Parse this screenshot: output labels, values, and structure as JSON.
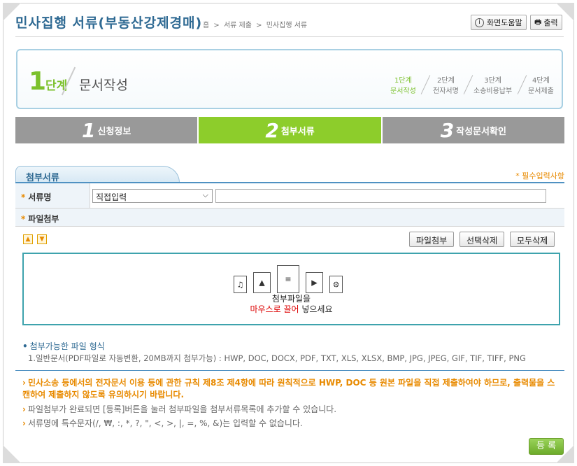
{
  "header": {
    "title": "민사집행 서류(부동산강제경매)",
    "breadcrumb": [
      "홈",
      ">",
      "서류 제출",
      ">",
      "민사집행 서류"
    ],
    "help_label": "화면도움말",
    "print_label": "출력"
  },
  "steps": {
    "current_num": "1",
    "current_label": "단계",
    "current_name": "문서작성",
    "mini": [
      {
        "top": "1단계",
        "bottom": "문서작성"
      },
      {
        "top": "2단계",
        "bottom": "전자서명"
      },
      {
        "top": "3단계",
        "bottom": "소송비용납부"
      },
      {
        "top": "4단계",
        "bottom": "문서제출"
      }
    ]
  },
  "tabs": [
    {
      "num": "1",
      "label": "신청정보"
    },
    {
      "num": "2",
      "label": "첨부서류"
    },
    {
      "num": "3",
      "label": "작성문서확인"
    }
  ],
  "section": {
    "tab_label": "첨부서류",
    "required_note": "* 필수입력사항",
    "doc_name_label": "서류명",
    "doc_select_value": "직접입력",
    "file_attach_label": "파일첨부",
    "buttons": {
      "attach": "파일첨부",
      "delete_selected": "선택삭제",
      "delete_all": "모두삭제"
    },
    "drop_line1": "첨부파일을",
    "drop_red": "마우스로 끌어",
    "drop_rest": " 넣으세요"
  },
  "formats": {
    "heading": "첨부가능한 파일 형식",
    "text": "1.일반문서(PDF파일로 자동변환, 20MB까지 첨부가능) : HWP, DOC, DOCX, PDF, TXT, XLS, XLSX, BMP, JPG, JPEG, GIF, TIF, TIFF, PNG"
  },
  "notes": {
    "main": "민사소송 등에서의 전자문서 이용 등에 관한 규칙 제8조 제4항에 따라 원칙적으로 HWP, DOC 등 원본 파일을 직접 제출하여야 하므로, 출력물을 스캔하여 제출하지 않도록 유의하시기 바랍니다.",
    "n1": "파일첨부가 완료되면 [등록]버튼을 눌러 첨부파일을 첨부서류목록에 추가할 수 있습니다.",
    "n2": "서류명에 특수문자(/, ₩, :, *, ?, \", <, >, |, =, %, &)는 입력할 수 없습니다."
  },
  "register_label": "등 록"
}
